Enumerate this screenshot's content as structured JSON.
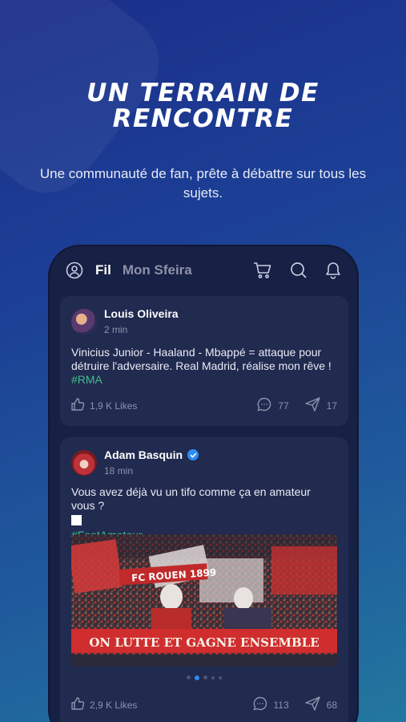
{
  "hero": {
    "title_line1": "UN TERRAIN DE",
    "title_line2": "RENCONTRE",
    "subtitle": "Une communauté de fan, prête à débattre sur tous les sujets."
  },
  "app": {
    "tabs": [
      {
        "label": "Fil",
        "active": true
      },
      {
        "label": "Mon Sfeira",
        "active": false
      }
    ],
    "icons": [
      "profile-icon",
      "cart-icon",
      "search-icon",
      "bell-icon"
    ]
  },
  "posts": [
    {
      "author": "Louis Oliveira",
      "time": "2 min",
      "text": "Vinicius Junior - Haaland - Mbappé = attaque pour détruire l'adversaire. Real Madrid, réalise mon rêve !",
      "hashtag": "#RMA",
      "likes": "1,9 K Likes",
      "comments": "77",
      "shares": "17"
    },
    {
      "author": "Adam Basquin",
      "verified": true,
      "time": "18 min",
      "text": "Vous avez déjà vu un tifo comme ça en amateur vous ?",
      "hashtag": "#FootAmateur",
      "banner_top": "FC ROUEN 1899",
      "banner_bottom": "ON LUTTE ET GAGNE ENSEMBLE",
      "carousel": {
        "count": 5,
        "active_index": 1
      },
      "likes": "2,9 K Likes",
      "comments": "113",
      "shares": "68"
    }
  ],
  "colors": {
    "accent_green": "#3fbf8e",
    "verified_blue": "#2d8cf0",
    "card_bg": "#212a4f",
    "phone_bg": "#172045"
  }
}
